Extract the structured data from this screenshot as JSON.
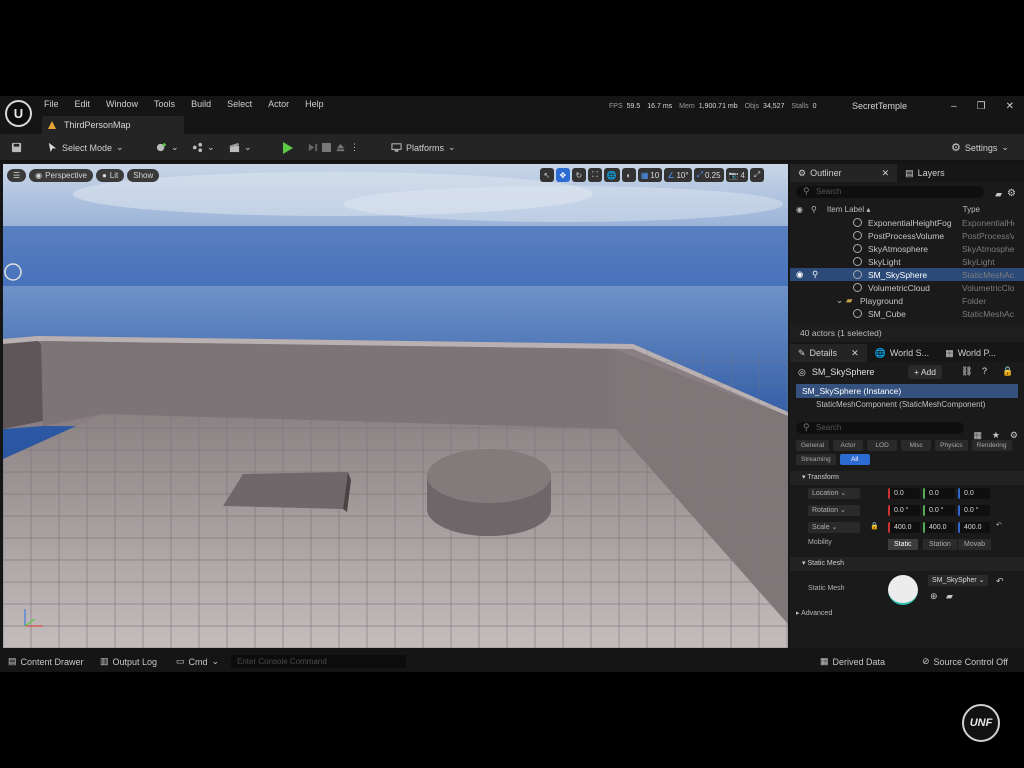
{
  "app": {
    "menus": [
      "File",
      "Edit",
      "Window",
      "Tools",
      "Build",
      "Select",
      "Actor",
      "Help"
    ],
    "map_tab": "ThirdPersonMap",
    "project": "SecretTemple",
    "stats": {
      "fps_label": "FPS",
      "fps_value": "59.5",
      "ms_value": "16.7 ms",
      "mem_label": "Mem",
      "mem_value": "1,900.71 mb",
      "objs_label": "Objs",
      "objs_value": "34,527",
      "stalls_label": "Stalls",
      "stalls_value": "0"
    },
    "window_controls": [
      "–",
      "❐",
      "✕"
    ]
  },
  "toolbar": {
    "select_mode": "Select Mode",
    "platforms": "Platforms",
    "settings": "Settings"
  },
  "viewport": {
    "perspective": "Perspective",
    "lit": "Lit",
    "show": "Show",
    "grid_snap": "10",
    "rot_snap": "10°",
    "scale_snap": "0.25",
    "camera_speed": "4"
  },
  "outliner": {
    "tab": "Outliner",
    "layers_tab": "Layers",
    "search_placeholder": "Search",
    "col_label": "Item Label ▴",
    "col_type": "Type",
    "rows": [
      {
        "name": "ExponentialHeightFog",
        "type": "ExponentialHeightFog",
        "selected": false
      },
      {
        "name": "PostProcessVolume",
        "type": "PostProcessVolume",
        "selected": false
      },
      {
        "name": "SkyAtmosphere",
        "type": "SkyAtmosphere",
        "selected": false
      },
      {
        "name": "SkyLight",
        "type": "SkyLight",
        "selected": false
      },
      {
        "name": "SM_SkySphere",
        "type": "StaticMeshActor",
        "selected": true
      },
      {
        "name": "VolumetricCloud",
        "type": "VolumetricCloud",
        "selected": false
      },
      {
        "name": "Playground",
        "type": "Folder",
        "selected": false
      },
      {
        "name": "SM_Cube",
        "type": "StaticMeshActor",
        "selected": false
      }
    ],
    "footer": "40 actors (1 selected)"
  },
  "details": {
    "tab": "Details",
    "tab2": "World S...",
    "tab3": "World P...",
    "actor_name": "SM_SkySphere",
    "add_label": "+ Add",
    "instance": "SM_SkySphere (Instance)",
    "component": "StaticMeshComponent (StaticMeshComponent)",
    "search_placeholder": "Search",
    "filters_row1": [
      "General",
      "Actor",
      "LOD",
      "Misc",
      "Physics"
    ],
    "filters_row2": [
      "Rendering",
      "Streaming",
      "All"
    ],
    "transform_header": "Transform",
    "location_label": "Location",
    "rotation_label": "Rotation",
    "scale_label": "Scale",
    "location": [
      "0.0",
      "0.0",
      "0.0"
    ],
    "rotation": [
      "0.0 °",
      "0.0 °",
      "0.0 °"
    ],
    "scale": [
      "400.0",
      "400.0",
      "400.0"
    ],
    "mobility_label": "Mobility",
    "mobility_options": [
      "Static",
      "Station",
      "Movab"
    ],
    "static_mesh_header": "Static Mesh",
    "static_mesh_label": "Static Mesh",
    "static_mesh_value": "SM_SkySpher",
    "advanced": "Advanced"
  },
  "statusbar": {
    "content_drawer": "Content Drawer",
    "output_log": "Output Log",
    "cmd": "Cmd",
    "console_placeholder": "Enter Console Command",
    "derived_data": "Derived Data",
    "source_control": "Source Control Off"
  },
  "watermark": "UNF",
  "colors": {
    "accent": "#2c6bd2",
    "selection": "#2b4a78",
    "play": "#5ec946",
    "sky": "#2f58a1"
  }
}
